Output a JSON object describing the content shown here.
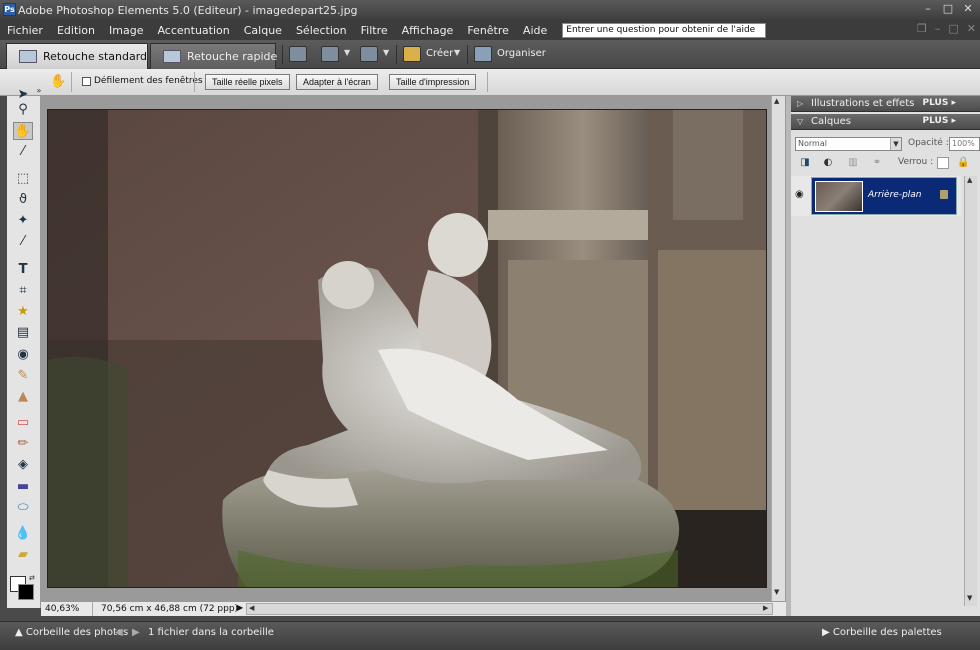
{
  "window": {
    "title": "Adobe Photoshop Elements 5.0 (Editeur) - imagedepart25.jpg"
  },
  "menu": {
    "items": [
      "Fichier",
      "Edition",
      "Image",
      "Accentuation",
      "Calque",
      "Sélection",
      "Filtre",
      "Affichage",
      "Fenêtre",
      "Aide"
    ],
    "help_value": "Entrer une question pour obtenir de l'aide"
  },
  "modes": {
    "standard": "Retouche standard",
    "quick": "Retouche rapide",
    "create": "Créer",
    "organize": "Organiser"
  },
  "options": {
    "scroll_all": "Défilement des fenêtres",
    "actual_pixels": "Taille réelle pixels",
    "fit_screen": "Adapter à l'écran",
    "print_size": "Taille d'impression"
  },
  "status": {
    "zoom": "40,63%",
    "doc_size": "70,56 cm x 46,88 cm (72 ppp)"
  },
  "palettes": {
    "effects": {
      "title": "Illustrations et effets",
      "plus": "PLUS"
    },
    "layers": {
      "title": "Calques",
      "plus": "PLUS",
      "blend_mode": "Normal",
      "opacity_label": "Opacité :",
      "opacity_value": "100%",
      "lock_label": "Verrou :",
      "layer_name": "Arrière-plan"
    }
  },
  "bottom": {
    "photo_bin": "Corbeille des photos",
    "bin_count": "1 fichier dans la corbeille",
    "palette_bin": "Corbeille des palettes"
  },
  "colors": {
    "layer_selected": "#0a2a78",
    "photo_bin_bg": "#4a4a4a"
  }
}
